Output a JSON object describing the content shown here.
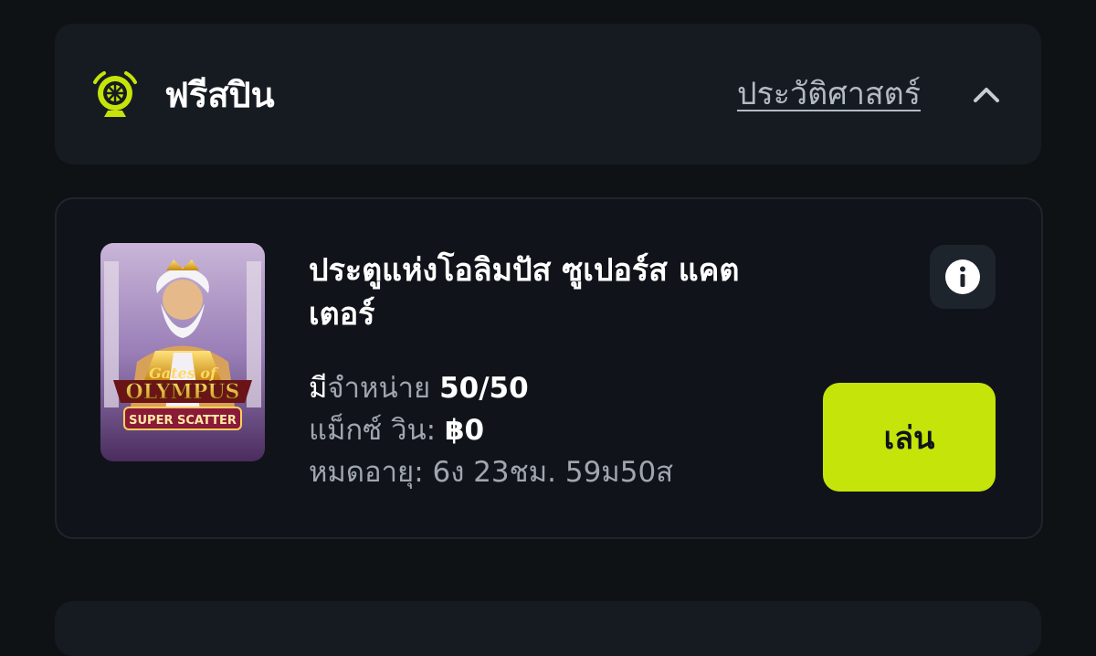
{
  "header": {
    "title": "ฟรีสปิน",
    "history_link": "ประวัติศาสตร์"
  },
  "offer": {
    "game_title": "ประตูแห่งโอลิมปัส ซูเปอร์ส แคตเตอร์",
    "thumbnail": {
      "line1": "Gates of",
      "line2": "OLYMPUS",
      "line3": "SUPER SCATTER"
    },
    "available": {
      "label_strong": "มี",
      "label": "จำหน่าย",
      "value": "50/50"
    },
    "max_win": {
      "label": "แม็กซ์ วิน:",
      "value": "฿0"
    },
    "expiry": {
      "label": "หมดอายุ:",
      "value": "6ง 23ชม. 59ม50ส"
    },
    "play_label": "เล่น"
  },
  "icons": {
    "header": "wheel-icon",
    "collapse": "chevron-up-icon",
    "info": "info-icon"
  },
  "colors": {
    "accent": "#c5e40a",
    "background": "#0f1215",
    "card": "#161b22"
  }
}
